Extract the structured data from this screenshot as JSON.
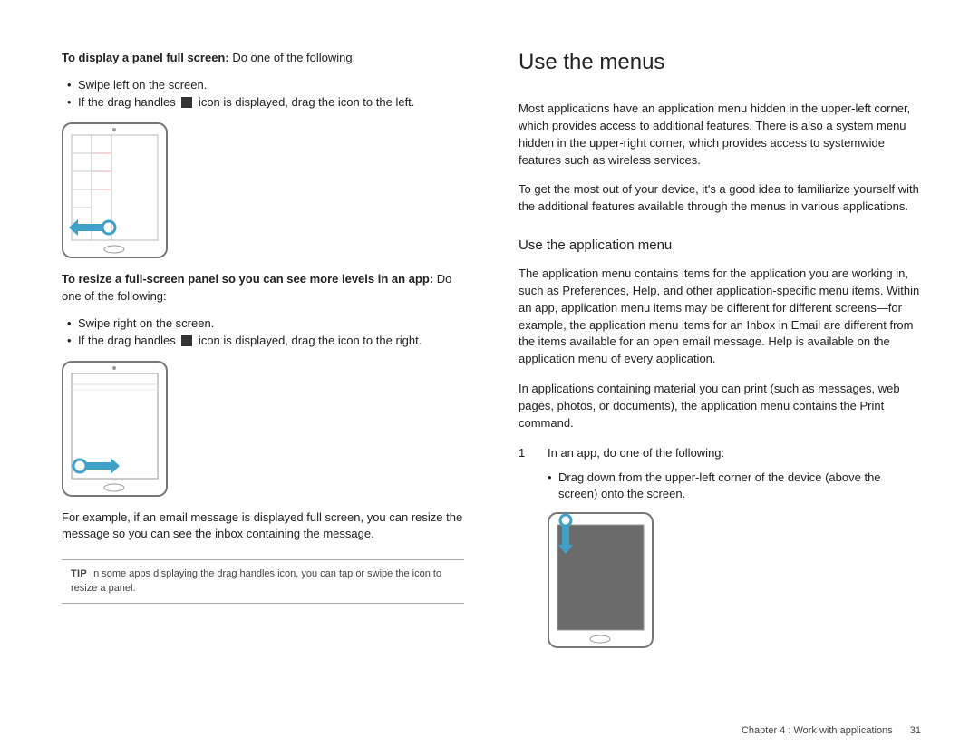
{
  "left": {
    "sec1_lead_bold": "To display a panel full screen:",
    "sec1_lead_rest": " Do one of the following:",
    "sec1_b1": "Swipe left on the screen.",
    "sec1_b2a": "If the drag handles ",
    "sec1_b2b": " icon is displayed, drag the icon to the left.",
    "sec2_lead_bold": "To resize a full-screen panel so you can see more levels in an app:",
    "sec2_lead_rest": " Do one of the following:",
    "sec2_b1": "Swipe right on the screen.",
    "sec2_b2a": "If the drag handles ",
    "sec2_b2b": " icon is displayed, drag the icon to the right.",
    "example": "For example, if an email message is displayed full screen, you can resize the message so you can see the inbox containing the message.",
    "tip_label": "TIP",
    "tip_text": "In some apps displaying the drag handles icon, you can tap or swipe the icon to resize a panel."
  },
  "right": {
    "h1": "Use the menus",
    "p1": "Most applications have an application menu hidden in the upper-left corner, which provides access to additional features. There is also a system menu hidden in the upper-right corner, which provides access to systemwide features such as wireless services.",
    "p2": "To get the most out of your device, it's a good idea to familiarize yourself with the additional features available through the menus in various applications.",
    "h2": "Use the application menu",
    "p3": "The application menu contains items for the application you are working in, such as Preferences, Help, and other application-specific menu items. Within an app, application menu items may be different for different screens—for example, the application menu items for an Inbox in Email are different from the items available for an open email message. Help is available on the application menu of every application.",
    "p4": "In applications containing material you can print (such as messages, web pages, photos, or documents), the application menu contains the Print command.",
    "step_n": "1",
    "step_text": "In an app, do one of the following:",
    "step_b1": "Drag down from the upper-left corner of the device (above the screen) onto the screen."
  },
  "footer": {
    "chapter": "Chapter 4 : Work with applications",
    "page": "31"
  }
}
